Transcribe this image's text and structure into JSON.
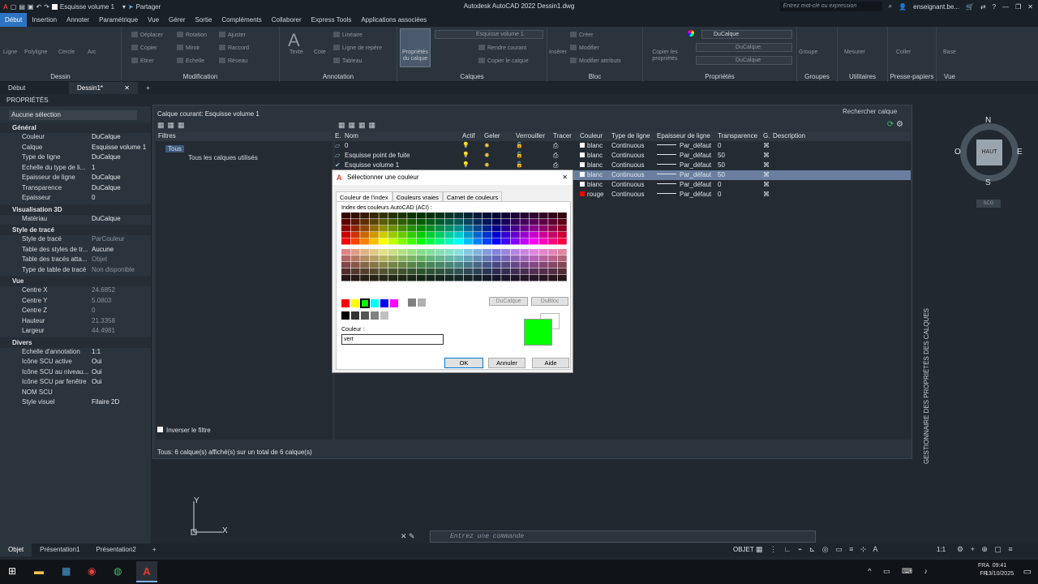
{
  "title_bar": {
    "layer_dropdown": "Esquisse volume 1",
    "share": "Partager",
    "title": "Autodesk AutoCAD 2022   Dessin1.dwg",
    "search_placeholder": "Entrez mot-clé ou expression",
    "user": "enseignant.be..."
  },
  "menu_tabs": [
    "Début",
    "Insertion",
    "Annoter",
    "Paramétrique",
    "Vue",
    "Gérer",
    "Sortie",
    "Compléments",
    "Collaborer",
    "Express Tools",
    "Applications associées"
  ],
  "ribbon": {
    "panels": [
      {
        "title": "Dessin",
        "buttons": [
          "Ligne",
          "Polyligne",
          "Cercle",
          "Arc"
        ]
      },
      {
        "title": "Modification",
        "buttons": [
          "Déplacer",
          "Rotation",
          "Ajuster",
          "Copier",
          "Miroir",
          "Raccord",
          "Etirer",
          "Echelle",
          "Réseau"
        ]
      },
      {
        "title": "Annotation",
        "buttons": [
          "Texte",
          "Cote",
          "Linéaire",
          "Ligne de repère",
          "Tableau"
        ]
      },
      {
        "title": "Calques",
        "buttons": [
          "Propriétés du calque",
          "Rendre courant",
          "Copier le calque"
        ],
        "current": "Esquisse volume 1"
      },
      {
        "title": "Bloc",
        "buttons": [
          "Insérer",
          "Créer",
          "Modifier",
          "Modifier attributs"
        ]
      },
      {
        "title": "Propriétés",
        "buttons": [
          "Copier les propriétés"
        ],
        "color": "DuCalque",
        "linetype": "DuCalque",
        "lineweight": "DuCalque"
      },
      {
        "title": "Groupes",
        "buttons": [
          "Groupe"
        ]
      },
      {
        "title": "Utilitaires",
        "buttons": [
          "Mesurer"
        ]
      },
      {
        "title": "Presse-papiers",
        "buttons": [
          "Coller"
        ]
      },
      {
        "title": "Vue",
        "buttons": [
          "Base"
        ]
      }
    ]
  },
  "doc_tabs": [
    "Début",
    "Dessin1*"
  ],
  "properties": {
    "header": "PROPRIÉTÉS",
    "selection": "Aucune sélection",
    "sections": [
      {
        "name": "Général",
        "rows": [
          [
            "Couleur",
            "DuCalque"
          ],
          [
            "Calque",
            "Esquisse volume 1"
          ],
          [
            "Type de ligne",
            "DuCalque"
          ],
          [
            "Echelle du type de li...",
            "1"
          ],
          [
            "Epaisseur de ligne",
            "DuCalque"
          ],
          [
            "Transparence",
            "DuCalque"
          ],
          [
            "Epaisseur",
            "0"
          ]
        ]
      },
      {
        "name": "Visualisation 3D",
        "rows": [
          [
            "Matériau",
            "DuCalque"
          ]
        ]
      },
      {
        "name": "Style de tracé",
        "rows": [
          [
            "Style de tracé",
            "ParCouleur"
          ],
          [
            "Table des styles de tr...",
            "Aucune"
          ],
          [
            "Table des tracés atta...",
            "Objet"
          ],
          [
            "Type de table de tracé",
            "Non disponible"
          ]
        ]
      },
      {
        "name": "Vue",
        "rows": [
          [
            "Centre X",
            "24.6852"
          ],
          [
            "Centre Y",
            "5.0803"
          ],
          [
            "Centre Z",
            "0"
          ],
          [
            "Hauteur",
            "21.3358"
          ],
          [
            "Largeur",
            "44.4981"
          ]
        ]
      },
      {
        "name": "Divers",
        "rows": [
          [
            "Echelle d'annotation",
            "1:1"
          ],
          [
            "Icône SCU active",
            "Oui"
          ],
          [
            "Icône SCU au niveau...",
            "Oui"
          ],
          [
            "Icône SCU par fenêtre",
            "Oui"
          ],
          [
            "NOM SCU",
            ""
          ],
          [
            "Style visuel",
            "Filaire 2D"
          ]
        ]
      }
    ]
  },
  "layer_manager": {
    "current": "Calque courant: Esquisse volume 1",
    "search": "Rechercher calque",
    "filters_header": "Filtres",
    "tree": [
      "Tous",
      "Tous les calques utilisés"
    ],
    "invert_filter": "Inverser le filtre",
    "footer": "Tous: 6 calque(s) affiché(s) sur un total de 6 calque(s)",
    "side_label": "GESTIONNAIRE DES PROPRIÉTÉS DES CALQUES",
    "columns": [
      "E.",
      "Nom",
      "Actif",
      "Geler",
      "Verrouiller",
      "Tracer",
      "Couleur",
      "Type de ligne",
      "Epaisseur de ligne",
      "Transparence",
      "G.",
      "Description"
    ],
    "rows": [
      {
        "name": "0",
        "color": "blanc",
        "linetype": "Continuous",
        "lineweight": "Par_défaut",
        "transparency": "0",
        "selected": false,
        "swatch": "#ffffff"
      },
      {
        "name": "Esquisse point de fuite",
        "color": "blanc",
        "linetype": "Continuous",
        "lineweight": "Par_défaut",
        "transparency": "50",
        "selected": false,
        "swatch": "#ffffff"
      },
      {
        "name": "Esquisse volume 1",
        "color": "blanc",
        "linetype": "Continuous",
        "lineweight": "Par_défaut",
        "transparency": "50",
        "selected": false,
        "swatch": "#ffffff"
      },
      {
        "name": "",
        "color": "blanc",
        "linetype": "Continuous",
        "lineweight": "Par_défaut",
        "transparency": "50",
        "selected": true,
        "swatch": "#ffffff"
      },
      {
        "name": "",
        "color": "blanc",
        "linetype": "Continuous",
        "lineweight": "Par_défaut",
        "transparency": "0",
        "selected": false,
        "swatch": "#ffffff"
      },
      {
        "name": "",
        "color": "rouge",
        "linetype": "Continuous",
        "lineweight": "Par_défaut",
        "transparency": "0",
        "selected": false,
        "swatch": "#ff0000"
      }
    ]
  },
  "color_dialog": {
    "title": "Sélectionner une couleur",
    "tabs": [
      "Couleur de l'index",
      "Couleurs vraies",
      "Carnet de couleurs"
    ],
    "aci_label": "Index des couleurs AutoCAD (ACI) :",
    "bylayer": "DuCalque",
    "byblock": "DuBloc",
    "color_label": "Couleur :",
    "color_value": "vert",
    "preview_color": "#00ff00",
    "ok": "OK",
    "cancel": "Annuler",
    "help": "Aide"
  },
  "viewcube": {
    "n": "N",
    "s": "S",
    "e": "E",
    "w": "O",
    "face": "HAUT",
    "wcs": "SCG"
  },
  "command_placeholder": "Entrez une commande",
  "layout_tabs": [
    "Objet",
    "Présentation1",
    "Présentation2"
  ],
  "status": {
    "mode": "OBJET",
    "scale": "1:1"
  },
  "taskbar": {
    "lang1": "FRA",
    "lang2": "FR",
    "time": "09:41",
    "date": "13/10/2025"
  }
}
